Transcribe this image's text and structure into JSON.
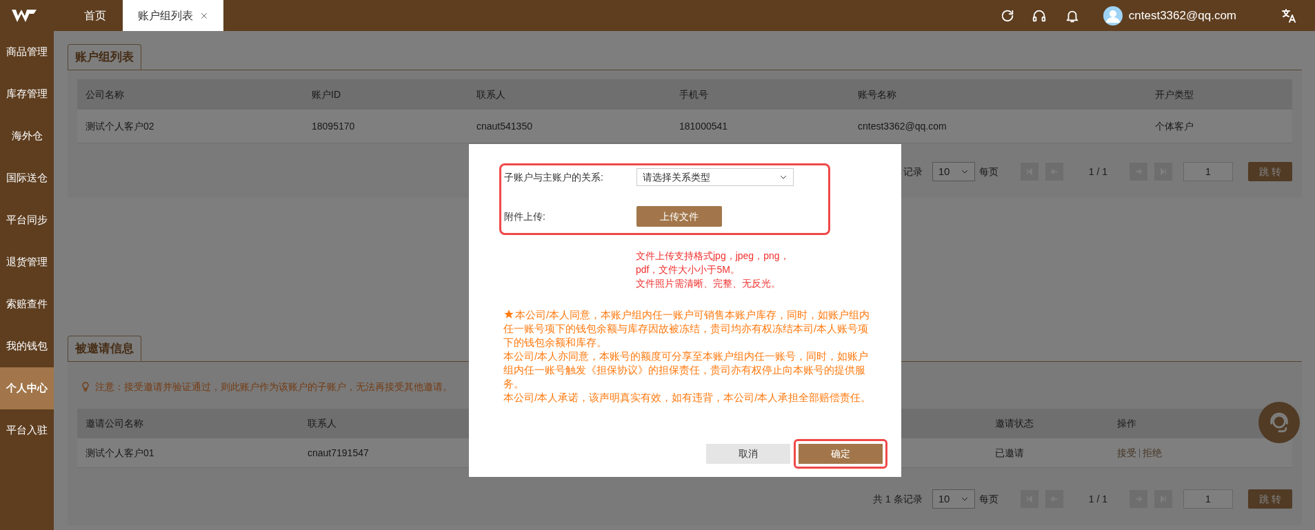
{
  "header": {
    "tabs": [
      {
        "label": "首页",
        "selected": false,
        "closable": false
      },
      {
        "label": "账户组列表",
        "selected": true,
        "closable": true
      }
    ],
    "user_email": "cntest3362@qq.com"
  },
  "sidebar": {
    "items": [
      {
        "label": "商品管理",
        "selected": false
      },
      {
        "label": "库存管理",
        "selected": false
      },
      {
        "label": "海外仓",
        "selected": false
      },
      {
        "label": "国际送仓",
        "selected": false
      },
      {
        "label": "平台同步",
        "selected": false
      },
      {
        "label": "退货管理",
        "selected": false
      },
      {
        "label": "索赔查件",
        "selected": false
      },
      {
        "label": "我的钱包",
        "selected": false
      },
      {
        "label": "个人中心",
        "selected": true
      },
      {
        "label": "平台入驻",
        "selected": false
      }
    ]
  },
  "account_group_panel": {
    "title": "账户组列表",
    "table": {
      "columns": [
        "公司名称",
        "账户ID",
        "联系人",
        "手机号",
        "账号名称",
        "开户类型"
      ],
      "rows": [
        [
          "测试个人客户02",
          "18095170",
          "cnaut541350",
          "181000541",
          "cntest3362@qq.com",
          "个体客户"
        ]
      ]
    },
    "pager": {
      "count": "记录",
      "page_size": "10",
      "per_page": "每页",
      "page": "1 / 1",
      "jump_value": "1",
      "jump_button": "跳 转"
    }
  },
  "invitation_panel": {
    "title": "被邀请信息",
    "notice": "注意：接受邀请并验证通过，则此账户作为该账户的子账户，无法再接受其他邀请。",
    "table": {
      "columns": [
        "邀请公司名称",
        "联系人",
        "邀请状态",
        "操作"
      ],
      "rows": [
        {
          "cells": [
            "测试个人客户01",
            "cnaut7191547",
            "已邀请"
          ],
          "actions": [
            "接受",
            "拒绝"
          ]
        }
      ]
    },
    "pager": {
      "count": "共 1 条记录",
      "page_size": "10",
      "per_page": "每页",
      "page": "1 / 1",
      "jump_value": "1",
      "jump_button": "跳 转"
    }
  },
  "dialog": {
    "form_highlighted": true,
    "relation_label": "子账户与主账户的关系:",
    "relation_placeholder": "请选择关系类型",
    "upload_label": "附件上传:",
    "upload_button": "上传文件",
    "hint_lines": [
      "文件上传支持格式jpg，jpeg，png，",
      "pdf，文件大小小于5M。",
      "文件照片需清晰、完整、无反光。"
    ],
    "statement": [
      "本公司/本人同意，本账户组内任一账户可销售本账户库存，同时，如账户组内任一账号项下的钱包余额与库存因故被冻结，贵司均亦有权冻结本司/本人账号项下的钱包余额和库存。",
      "本公司/本人亦同意，本账号的额度可分享至本账户组内任一账号，同时，如账户组内任一账号触发《担保协议》的担保责任，贵司亦有权停止向本账号的提供服务。",
      "本公司/本人承诺，该声明真实有效，如有违背，本公司/本人承担全部赔偿责任。"
    ],
    "cancel_button": "取消",
    "confirm_button": "确定",
    "confirm_highlighted": true
  }
}
